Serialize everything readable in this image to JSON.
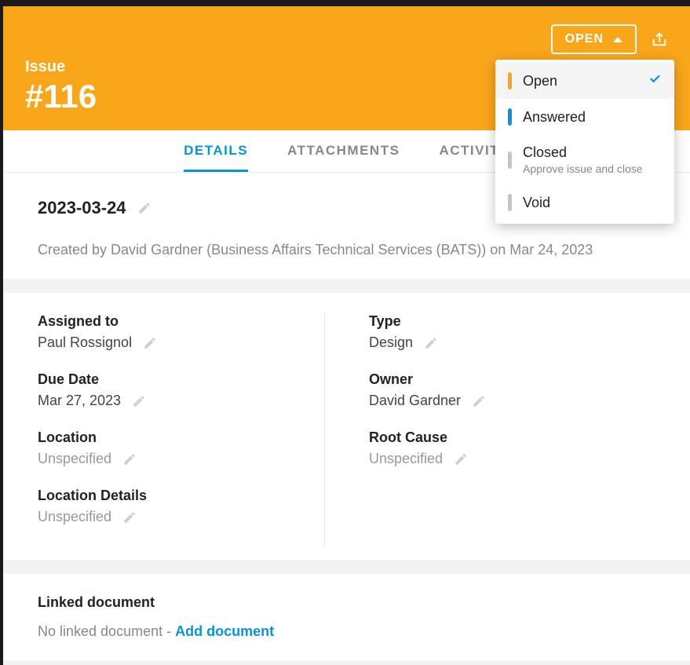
{
  "header": {
    "label": "Issue",
    "id": "#116",
    "status_button": "OPEN"
  },
  "dropdown": {
    "items": [
      {
        "label": "Open",
        "color": "orange",
        "selected": true
      },
      {
        "label": "Answered",
        "color": "blue",
        "selected": false
      },
      {
        "label": "Closed",
        "color": "gray",
        "sub": "Approve issue and close",
        "selected": false
      },
      {
        "label": "Void",
        "color": "gray",
        "selected": false
      }
    ]
  },
  "tabs": {
    "details": "DETAILS",
    "attachments": "ATTACHMENTS",
    "activity": "ACTIVITY"
  },
  "summary": {
    "title": "2023-03-24",
    "created_by": "Created by David Gardner (Business Affairs Technical Services (BATS)) on Mar 24, 2023"
  },
  "fields": {
    "assigned_to": {
      "label": "Assigned to",
      "value": "Paul Rossignol"
    },
    "due_date": {
      "label": "Due Date",
      "value": "Mar 27, 2023"
    },
    "location": {
      "label": "Location",
      "value": "Unspecified"
    },
    "location_details": {
      "label": "Location Details",
      "value": "Unspecified"
    },
    "type": {
      "label": "Type",
      "value": "Design"
    },
    "owner": {
      "label": "Owner",
      "value": "David Gardner"
    },
    "root_cause": {
      "label": "Root Cause",
      "value": "Unspecified"
    }
  },
  "linked": {
    "title": "Linked document",
    "text": "No linked document - ",
    "action": "Add document"
  }
}
